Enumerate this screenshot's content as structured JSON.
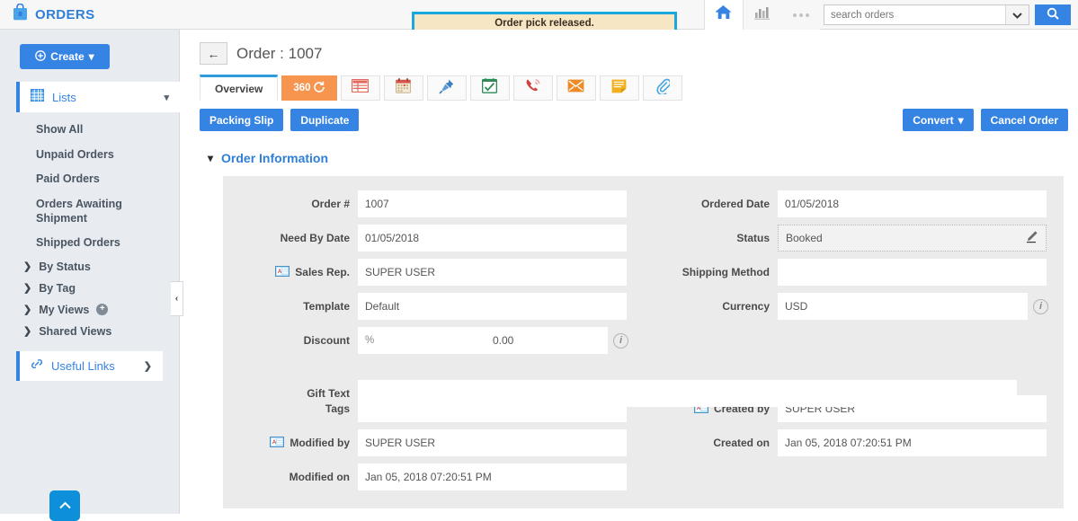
{
  "app": {
    "brand": "ORDERS",
    "brand_icon": "shopping-bag-icon",
    "accent_blue": "#3584e4",
    "flash_border": "#1aa7e0",
    "flash_bg": "#f7e6c4"
  },
  "flash": {
    "message": "Order pick released."
  },
  "search": {
    "placeholder": "search orders",
    "value": ""
  },
  "topbar": {
    "home_icon": "home-icon",
    "chart_icon": "bar-chart-icon",
    "more_icon": "more-dots-icon",
    "dropdown_icon": "chevron-down-icon",
    "search_icon": "search-icon"
  },
  "sidebar": {
    "create_label": "Create",
    "lists_label": "Lists",
    "lists_items": [
      "Show All",
      "Unpaid Orders",
      "Paid Orders",
      "Orders Awaiting Shipment",
      "Shipped Orders"
    ],
    "groups": [
      {
        "label": "By Status",
        "has_plus": false
      },
      {
        "label": "By Tag",
        "has_plus": false
      },
      {
        "label": "My Views",
        "has_plus": true
      },
      {
        "label": "Shared Views",
        "has_plus": false
      }
    ],
    "useful_links_label": "Useful Links",
    "collapse_label": "‹"
  },
  "page": {
    "back_label": "←",
    "title": "Order : 1007"
  },
  "tabs": [
    {
      "label": "Overview",
      "type": "text",
      "active": true,
      "name": "tab-overview"
    },
    {
      "label": "360",
      "type": "360",
      "active": false,
      "name": "tab-360"
    },
    {
      "label": "",
      "type": "icon",
      "icon": "table-icon",
      "name": "tab-line-items"
    },
    {
      "label": "",
      "type": "icon",
      "icon": "calendar-icon",
      "name": "tab-calendar"
    },
    {
      "label": "",
      "type": "icon",
      "icon": "pushpin-icon",
      "name": "tab-pinned"
    },
    {
      "label": "",
      "type": "icon",
      "icon": "checklist-icon",
      "name": "tab-tasks"
    },
    {
      "label": "",
      "type": "icon",
      "icon": "phone-icon",
      "name": "tab-calls"
    },
    {
      "label": "",
      "type": "icon",
      "icon": "envelope-icon",
      "name": "tab-emails"
    },
    {
      "label": "",
      "type": "icon",
      "icon": "note-icon",
      "name": "tab-notes"
    },
    {
      "label": "",
      "type": "icon",
      "icon": "paperclip-icon",
      "name": "tab-attachments"
    }
  ],
  "actions": {
    "packing_slip": "Packing Slip",
    "duplicate": "Duplicate",
    "convert": "Convert",
    "cancel_order": "Cancel Order"
  },
  "section": {
    "title": "Order Information",
    "collapse_icon": "chevron-down-icon"
  },
  "form": {
    "left": [
      {
        "label": "Order #",
        "value": "1007",
        "icon": null,
        "info": false
      },
      {
        "label": "Need By Date",
        "value": "01/05/2018",
        "icon": null,
        "info": false
      },
      {
        "label": "Sales Rep.",
        "value": "SUPER USER",
        "icon": "contact-card-icon",
        "info": false
      },
      {
        "label": "Template",
        "value": "Default",
        "icon": null,
        "info": false
      },
      {
        "label": "Discount",
        "value": "0.00",
        "prefix": "%",
        "icon": null,
        "info": true
      }
    ],
    "right": [
      {
        "label": "Ordered Date",
        "value": "01/05/2018",
        "icon": null,
        "info": false
      },
      {
        "label": "Status",
        "value": "Booked",
        "icon": null,
        "info": false,
        "editable": true
      },
      {
        "label": "Shipping Method",
        "value": "",
        "icon": null,
        "info": false
      },
      {
        "label": "Currency",
        "value": "USD",
        "icon": null,
        "info": true
      }
    ],
    "full": [
      {
        "label": "Gift Text",
        "value": ""
      }
    ],
    "lower_left": [
      {
        "label": "Tags",
        "value": "",
        "icon": null
      },
      {
        "label": "Modified by",
        "value": "SUPER USER",
        "icon": "contact-card-icon"
      },
      {
        "label": "Modified on",
        "value": "Jan 05, 2018 07:20:51 PM",
        "icon": null
      }
    ],
    "lower_right": [
      {
        "label": "Created by",
        "value": "SUPER USER",
        "icon": "contact-card-icon"
      },
      {
        "label": "Created on",
        "value": "Jan 05, 2018 07:20:51 PM",
        "icon": null
      }
    ]
  }
}
